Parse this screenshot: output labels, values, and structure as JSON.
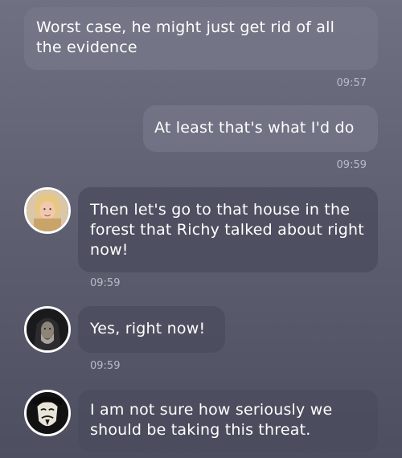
{
  "messages": [
    {
      "id": "m1",
      "direction": "outgoing",
      "text": "Worst case, he might just get rid of all the evidence",
      "time": "09:57"
    },
    {
      "id": "m2",
      "direction": "outgoing",
      "text": "At least that's what I'd do",
      "time": "09:59"
    },
    {
      "id": "m3",
      "direction": "incoming",
      "avatar": "blonde-woman-avatar",
      "text": "Then let's go to that house in the forest that Richy talked about right now!",
      "time": "09:59"
    },
    {
      "id": "m4",
      "direction": "incoming",
      "avatar": "hooded-man-avatar",
      "text": "Yes, right now!",
      "time": "09:59"
    },
    {
      "id": "m5",
      "direction": "incoming",
      "avatar": "guy-fawkes-mask-avatar",
      "text": "I am not sure how seriously we should be taking this threat.",
      "time": ""
    }
  ],
  "colors": {
    "background_top": "#6f7182",
    "background_bottom": "#4d4f61",
    "outgoing_bubble": "#8a8c9c",
    "incoming_bubble": "#4a4c5c",
    "text": "#ffffff",
    "timestamp": "#b9bac6"
  }
}
